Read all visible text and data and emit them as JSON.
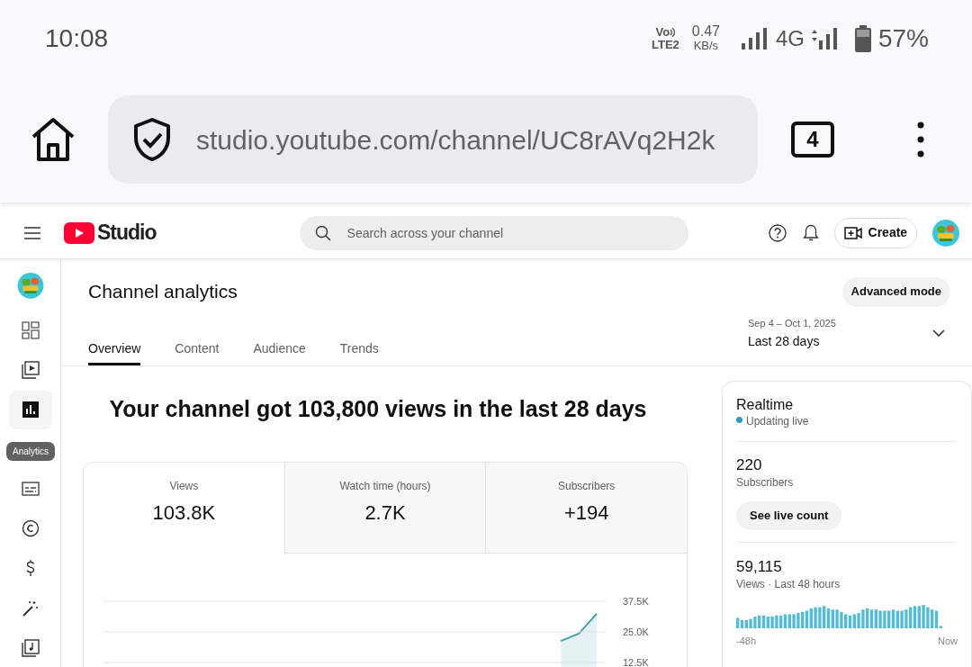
{
  "status_bar": {
    "time": "10:08",
    "volte_top": "Vo",
    "volte_bottom": "LTE2",
    "speed_value": "0.47",
    "speed_unit": "KB/s",
    "network": "4G",
    "battery": "57%"
  },
  "browser": {
    "url": "studio.youtube.com/channel/UC8rAVq2H2k",
    "tab_count": "4"
  },
  "header": {
    "logo_text": "Studio",
    "search_placeholder": "Search across your channel",
    "create_label": "Create"
  },
  "sidebar": {
    "items": [
      {
        "kind": "dashboard",
        "selected": false
      },
      {
        "kind": "content",
        "selected": false
      },
      {
        "kind": "analytics",
        "selected": true
      },
      {
        "kind": "subtitles",
        "selected": false
      },
      {
        "kind": "copyright",
        "selected": false
      },
      {
        "kind": "earn",
        "selected": false
      },
      {
        "kind": "customize",
        "selected": false
      },
      {
        "kind": "audio",
        "selected": false
      }
    ],
    "tooltip": "Analytics"
  },
  "page": {
    "title": "Channel analytics",
    "advanced_button": "Advanced mode"
  },
  "tabs": [
    {
      "label": "Overview",
      "selected": true
    },
    {
      "label": "Content",
      "selected": false
    },
    {
      "label": "Audience",
      "selected": false
    },
    {
      "label": "Trends",
      "selected": false
    }
  ],
  "date_range": {
    "dates": "Sep 4 – Oct 1, 2025",
    "label": "Last 28 days"
  },
  "headline": "Your channel got 103,800 views in the last 28 days",
  "metrics": [
    {
      "label": "Views",
      "value": "103.8K",
      "selected": true
    },
    {
      "label": "Watch time (hours)",
      "value": "2.7K",
      "selected": false
    },
    {
      "label": "Subscribers",
      "value": "+194",
      "selected": false
    }
  ],
  "chart_data": {
    "type": "area",
    "ylim": [
      12500,
      37500
    ],
    "yticks": [
      {
        "value": 12500,
        "label": "12.5K"
      },
      {
        "value": 25000,
        "label": "25.0K"
      },
      {
        "value": 37500,
        "label": "37.5K"
      }
    ],
    "series": [
      {
        "color": "#4b9eab",
        "values": [
          null,
          null,
          null,
          null,
          null,
          null,
          null,
          null,
          null,
          null,
          null,
          null,
          null,
          null,
          null,
          null,
          null,
          null,
          null,
          null,
          null,
          null,
          null,
          null,
          null,
          21300,
          24300,
          32400
        ]
      }
    ]
  },
  "realtime": {
    "title": "Realtime",
    "status": "Updating live",
    "subscribers_count": "220",
    "subscribers_label": "Subscribers",
    "button": "See live count",
    "views_count": "59,115",
    "views_label": "Views · Last 48 hours",
    "axis_start": "-48h",
    "axis_end": "Now"
  }
}
